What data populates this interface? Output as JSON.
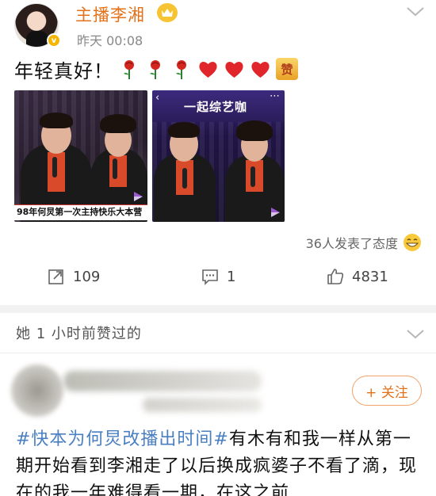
{
  "post": {
    "user_name": "主播李湘",
    "time": "昨天 00:08",
    "verified_mark": "v",
    "text": "年轻真好！",
    "emojis": [
      "rose-emoji",
      "rose-emoji",
      "rose-emoji",
      "heart-emoji",
      "heart-emoji",
      "heart-emoji",
      "zan-emoji"
    ],
    "zan_text": "赞",
    "images": [
      {
        "caption": "98年何炅第一次主持快乐大本营"
      },
      {
        "title": "一起综艺咖"
      }
    ],
    "reactions_text": "36人发表了态度",
    "actions": {
      "repost_count": "109",
      "comment_count": "1",
      "like_count": "4831"
    }
  },
  "liked_header": {
    "text": "她 1 小时前赞过的"
  },
  "post2": {
    "follow_label": "+ 关注",
    "hashtag": "#快本为何炅改播出时间#",
    "text": "有木有和我一样从第一期开始看到李湘走了以后换成疯婆子不看了滴，现在的我一年难得看一期，在这之前"
  },
  "colors": {
    "brand_orange": "#e37119",
    "link_blue": "#4a7fc1",
    "divider": "#f2f2f2"
  }
}
